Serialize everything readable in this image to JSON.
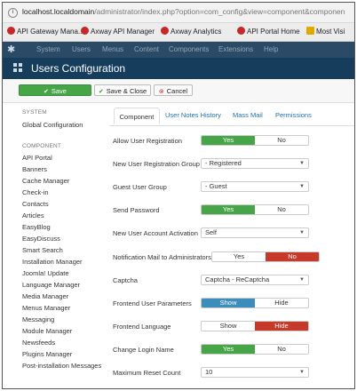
{
  "browser": {
    "url_host": "localhost.localdomain",
    "url_path": "/administrator/index.php?option=com_config&view=component&componen",
    "bookmarks": [
      "API Gateway Mana...",
      "Axway API Manager",
      "Axway Analytics",
      "API Portal Home",
      "Most Visi"
    ]
  },
  "topnav": {
    "items": [
      "System",
      "Users",
      "Menus",
      "Content",
      "Components",
      "Extensions",
      "Help"
    ]
  },
  "page_title": "Users Configuration",
  "toolbar": {
    "save_label": "Save",
    "save_close_label": "Save & Close",
    "cancel_label": "Cancel"
  },
  "sidebar": {
    "system_heading": "SYSTEM",
    "system_items": [
      "Global Configuration"
    ],
    "component_heading": "COMPONENT",
    "component_items": [
      "API Portal",
      "Banners",
      "Cache Manager",
      "Check-in",
      "Contacts",
      "Articles",
      "EasyBlog",
      "EasyDiscuss",
      "Smart Search",
      "Installation Manager",
      "Joomla! Update",
      "Language Manager",
      "Media Manager",
      "Menus Manager",
      "Messaging",
      "Module Manager",
      "Newsfeeds",
      "Plugins Manager",
      "Post-installation Messages"
    ]
  },
  "tabs": [
    "Component",
    "User Notes History",
    "Mass Mail",
    "Permissions"
  ],
  "form": {
    "rows": [
      {
        "label": "Allow User Registration",
        "type": "toggle",
        "options": [
          "Yes",
          "No"
        ],
        "selected": "Yes"
      },
      {
        "label": "New User Registration Group",
        "type": "select",
        "value": "- Registered"
      },
      {
        "label": "Guest User Group",
        "type": "select",
        "value": "- Guest"
      },
      {
        "label": "Send Password",
        "type": "toggle",
        "options": [
          "Yes",
          "No"
        ],
        "selected": "Yes"
      },
      {
        "label": "New User Account Activation",
        "type": "select",
        "value": "Self"
      },
      {
        "label": "Notification Mail to Administrators",
        "type": "toggle",
        "options": [
          "Yes",
          "No"
        ],
        "selected": "No"
      },
      {
        "label": "Captcha",
        "type": "select",
        "value": "Captcha - ReCaptcha"
      },
      {
        "label": "Frontend User Parameters",
        "type": "toggle",
        "options": [
          "Show",
          "Hide"
        ],
        "selected": "Show"
      },
      {
        "label": "Frontend Language",
        "type": "toggle",
        "options": [
          "Show",
          "Hide"
        ],
        "selected": "Hide"
      },
      {
        "label": "Change Login Name",
        "type": "toggle",
        "options": [
          "Yes",
          "No"
        ],
        "selected": "Yes"
      },
      {
        "label": "Maximum Reset Count",
        "type": "select",
        "value": "10"
      }
    ]
  },
  "colors": {
    "nav_bg": "#2b4a66",
    "title_bg": "#173d5c",
    "green": "#46a546",
    "red": "#c63a2c",
    "link": "#1f6fb3"
  },
  "icons": {
    "save": "check-icon",
    "save_close": "check-icon",
    "cancel": "cancel-circle-icon",
    "title": "users-grid-icon"
  }
}
